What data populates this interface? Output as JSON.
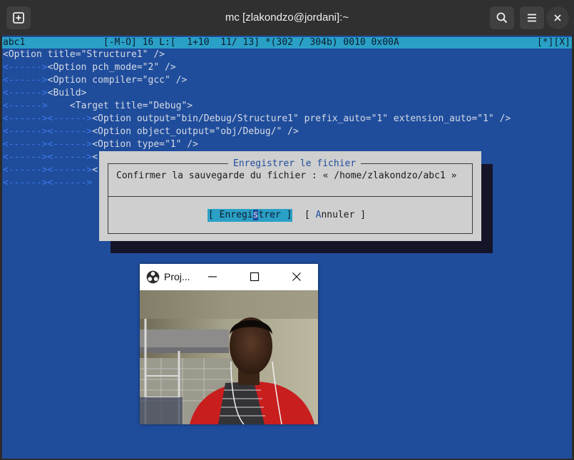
{
  "header": {
    "title": "mc [zlakondzo@jordani]:~",
    "new_tab_icon": "new-tab-icon",
    "search_icon": "search-icon",
    "menu_icon": "hamburger-menu-icon",
    "close_icon": "close-icon"
  },
  "editor": {
    "status_left": "abc1              [-M-O] 16 L:[  1+10  11/ 13] *(302 / 304b) 0010 0x00A",
    "status_right": "[*][X]",
    "tab_marker": "<------>",
    "lines": [
      {
        "tabs": "",
        "text": "<Option title=\"Structure1\" />"
      },
      {
        "tabs": "<------>",
        "text": "<Option pch_mode=\"2\" />"
      },
      {
        "tabs": "<------>",
        "text": "<Option compiler=\"gcc\" />"
      },
      {
        "tabs": "<------>",
        "text": "<Build>"
      },
      {
        "tabs": "<------>",
        "text": "    <Target title=\"Debug\">"
      },
      {
        "tabs": "<------><------>",
        "text": "<Option output=\"bin/Debug/Structure1\" prefix_auto=\"1\" extension_auto=\"1\" />"
      },
      {
        "tabs": "<------><------>",
        "text": "<Option object_output=\"obj/Debug/\" />"
      },
      {
        "tabs": "<------><------>",
        "text": "<Option type=\"1\" />"
      },
      {
        "tabs": "<------><------>",
        "text": "<"
      },
      {
        "tabs": "<------><------>",
        "text": "<"
      },
      {
        "tabs": "<------><------>",
        "text": ""
      }
    ]
  },
  "dialog": {
    "title": "Enregistrer le fichier",
    "message": "Confirmer la sauvegarde du fichier : « /home/zlakondzo/abc1 »",
    "save_button": {
      "before_cursor": "[ Enregi",
      "cursor_char": "s",
      "after_cursor": "trer ]"
    },
    "cancel_button": {
      "open": "[ ",
      "hotkey": "A",
      "rest": "nnuler ]"
    }
  },
  "camera_window": {
    "title": "Proj...",
    "app_icon": "obs-logo-icon",
    "minimize_icon": "minimize-icon",
    "maximize_icon": "maximize-icon",
    "close_icon": "close-icon"
  },
  "colors": {
    "terminal_bg": "#1f4d9c",
    "status_bar": "#2aa0c6",
    "tab_marker": "#3d78e8",
    "dialog_bg": "#cfcfcf",
    "header_bg": "#303030"
  }
}
